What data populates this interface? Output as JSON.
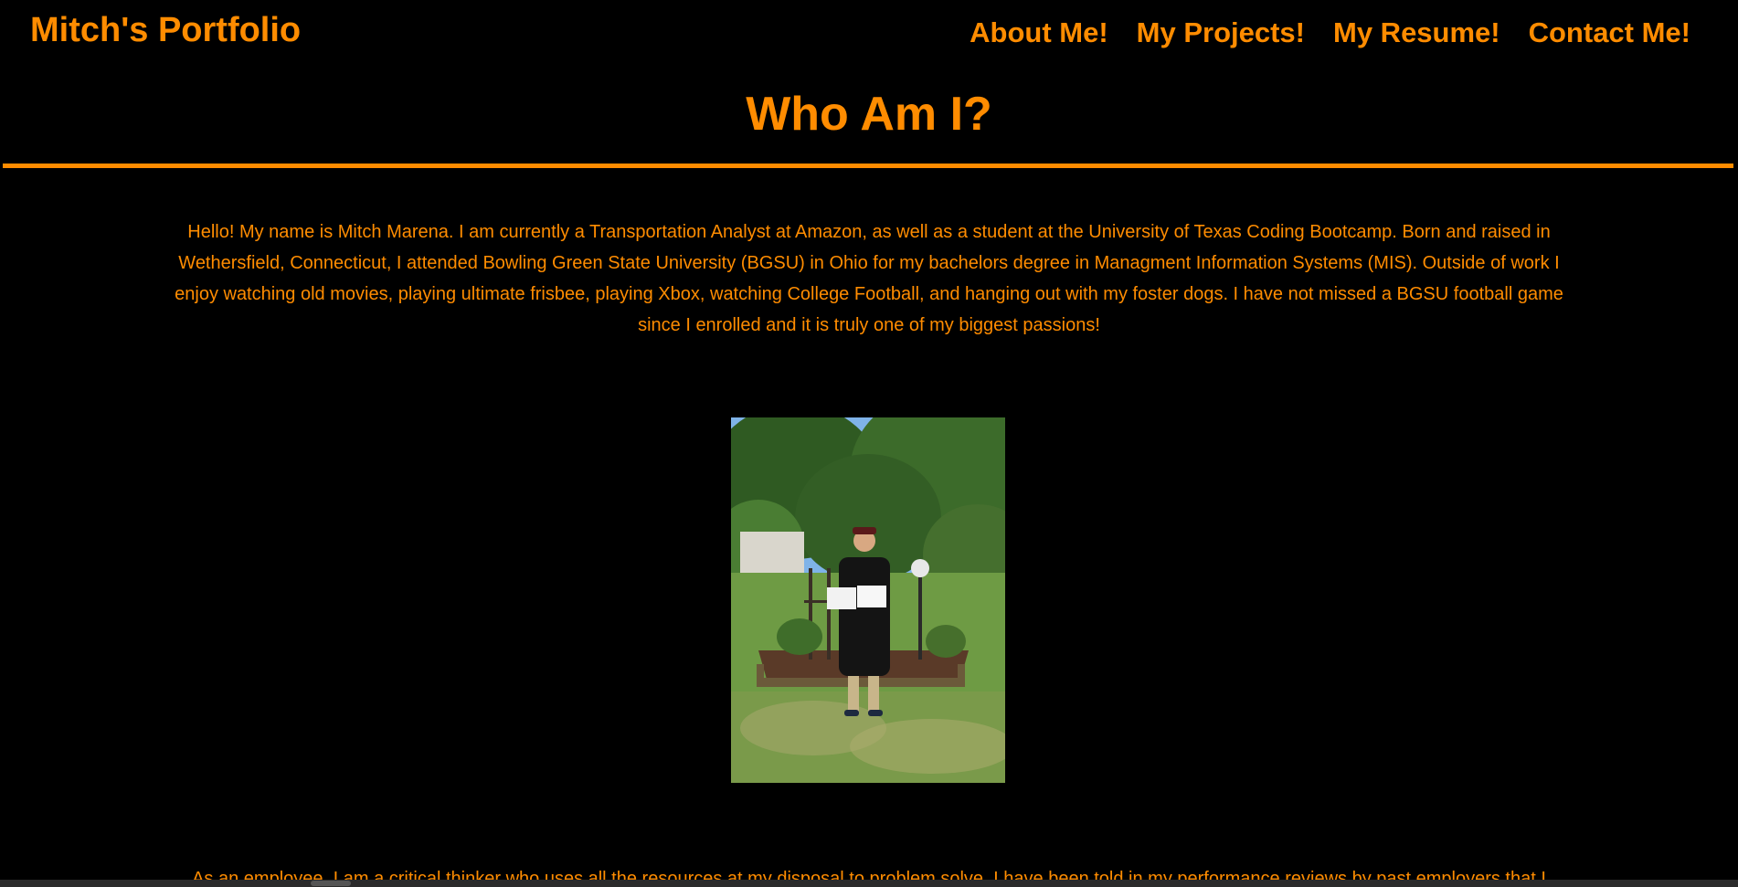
{
  "header": {
    "site_title": "Mitch's Portfolio",
    "nav": [
      {
        "label": "About Me!"
      },
      {
        "label": "My Projects!"
      },
      {
        "label": "My Resume!"
      },
      {
        "label": "Contact Me!"
      }
    ]
  },
  "main": {
    "heading": "Who Am I?",
    "intro": "Hello! My name is Mitch Marena. I am currently a Transportation Analyst at Amazon, as well as a student at the University of Texas Coding Bootcamp. Born and raised in Wethersfield, Connecticut, I attended Bowling Green State University (BGSU) in Ohio for my bachelors degree in Managment Information Systems (MIS). Outside of work I enjoy watching old movies, playing ultimate frisbee, playing Xbox, watching College Football, and hanging out with my foster dogs. I have not missed a BGSU football game since I enrolled and it is truly one of my biggest passions!",
    "photo_icon": "graduation-photo",
    "employee": "As an employee, I am a critical thinker who uses all the resources at my disposal to problem solve. I have been told in my performance reviews by past employers that I"
  },
  "theme": {
    "background": "#000000",
    "accent": "#ff8c00"
  }
}
